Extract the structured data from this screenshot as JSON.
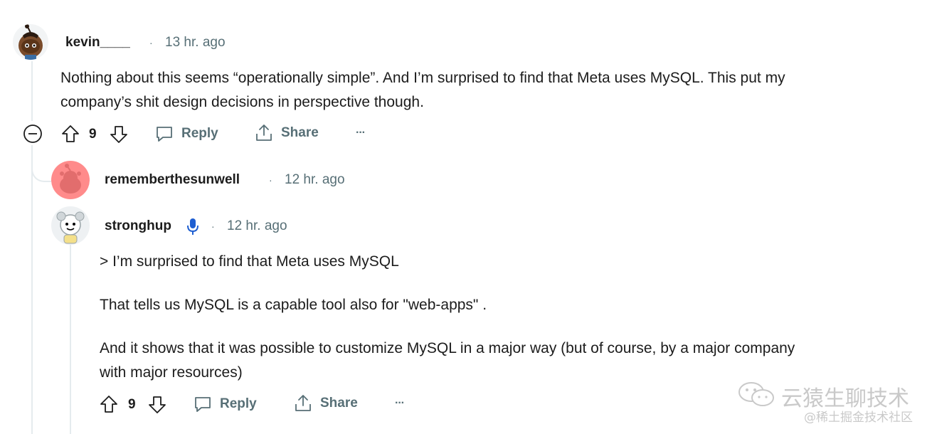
{
  "comments": [
    {
      "username": "kevin____",
      "separator": "·",
      "time": "13 hr. ago",
      "body": [
        "Nothing about this seems “operationally simple”. And I’m surprised to find that Meta uses MySQL. This put my",
        "company’s shit design decisions in perspective though."
      ],
      "score": "9",
      "reply_label": "Reply",
      "share_label": "Share",
      "more_label": "···"
    },
    {
      "username": "rememberthesunwell",
      "separator": "·",
      "time": "12 hr. ago"
    },
    {
      "username": "stronghup",
      "separator": "·",
      "time": "12 hr. ago",
      "body": [
        "> I’m surprised to find that Meta uses MySQL",
        "That tells us MySQL is a capable tool also for \"web-apps\" .",
        "And it shows that it was possible to customize MySQL in a major way (but of course, by a major company",
        "with major resources)"
      ],
      "score": "9",
      "reply_label": "Reply",
      "share_label": "Share",
      "more_label": "···"
    }
  ],
  "watermark": {
    "main": "云猿生聊技术",
    "sub": "@稀土掘金技术社区"
  },
  "icons": {
    "collapse": "collapse-circle-minus-icon",
    "upvote": "upvote-arrow-icon",
    "downvote": "downvote-arrow-icon",
    "reply": "speech-bubble-icon",
    "share": "share-upload-icon",
    "mic": "microphone-icon",
    "watermark": "wechat-icon"
  },
  "colors": {
    "meta_text": "#576f76",
    "thread_line": "#e5ebee",
    "mic_blue": "#1f5fd1",
    "avatar_pink": "#ff8b8b"
  }
}
